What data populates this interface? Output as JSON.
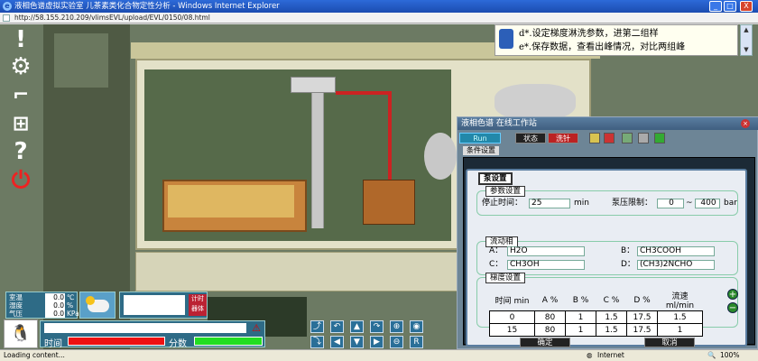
{
  "window": {
    "title": "液相色谱虚拟实验室 儿茶素类化合物定性分析 - Windows Internet Explorer",
    "url": "http://58.155.210.209/vlimsEVL/upload/EVL/0150/08.html",
    "buttons": {
      "minimize": "_",
      "maximize": "□",
      "close": "X"
    }
  },
  "status": {
    "text": "Loading content...",
    "zone": "Internet",
    "zoom": "100%"
  },
  "tip": {
    "line1": "d*.设定梯度淋洗参数，进第二组样",
    "line2": "e*.保存数据，查看出峰情况，对比两组峰"
  },
  "sensor": {
    "rows": [
      {
        "label": "室温",
        "value": "0.0",
        "unit": "℃"
      },
      {
        "label": "湿度",
        "value": "0.0",
        "unit": "%"
      },
      {
        "label": "气压",
        "value": "0.0",
        "unit": "KPa"
      }
    ]
  },
  "timer": {
    "label": "计时器体"
  },
  "score": {
    "time_label": "时间",
    "score_label": "分数"
  },
  "workstation": {
    "title": "液相色谱 在线工作站",
    "run": "Run",
    "tabs": [
      "状态",
      "洗针"
    ],
    "section": "条件设置",
    "axis_unit": "min"
  },
  "dialog": {
    "title": "泵设置",
    "params_title": "参数设置",
    "stop_time_label": "停止时间：",
    "stop_time": "25",
    "stop_time_unit": "min",
    "pressure_label": "泵压限制：",
    "pressure_min": "0",
    "pressure_sep": "~",
    "pressure_max": "400",
    "pressure_unit": "bar",
    "mobile_title": "流动相",
    "mobile": [
      {
        "key": "A：",
        "value": "H2O"
      },
      {
        "key": "B：",
        "value": "CH3COOH"
      },
      {
        "key": "C：",
        "value": "CH3OH"
      },
      {
        "key": "D：",
        "value": "(CH3)2NCHO"
      }
    ],
    "gradient_title": "梯度设置",
    "gradient_headers": [
      "时间 min",
      "A %",
      "B %",
      "C %",
      "D %",
      "流速 ml/min"
    ],
    "gradient_rows": [
      [
        "0",
        "80",
        "1",
        "1.5",
        "17.5",
        "1.5"
      ],
      [
        "15",
        "80",
        "1",
        "1.5",
        "17.5",
        "1"
      ]
    ],
    "ok": "确定",
    "cancel": "取消"
  },
  "colors": {
    "accent": "#2e6b86",
    "time_bar": "#e11111",
    "score_bar": "#22dd22"
  }
}
